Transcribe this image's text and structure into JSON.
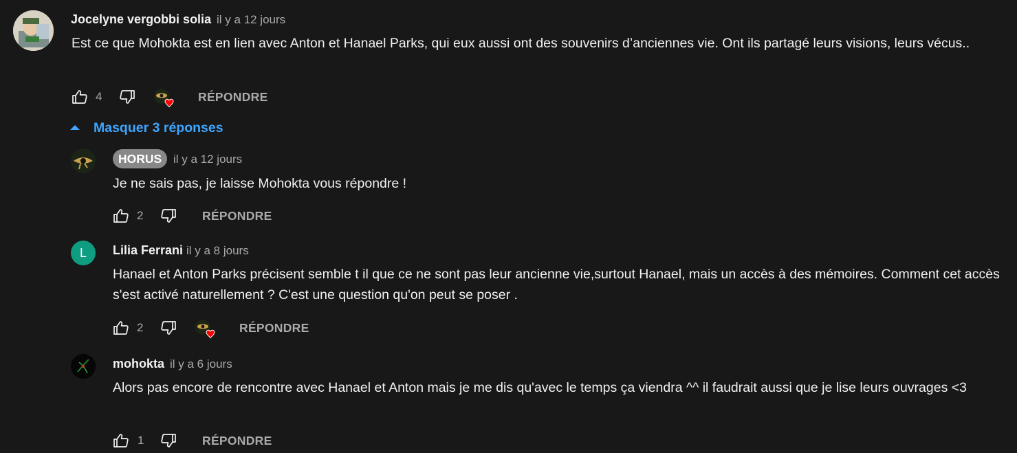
{
  "comments": [
    {
      "author": "Jocelyne vergobbi solia",
      "time": "il y a 12 jours",
      "text": "Est ce que Mohokta est en lien avec Anton et Hanael Parks, qui eux aussi ont des souvenirs d’anciennes vie. Ont ils partagé leurs visions, leurs vécus..",
      "likes": "4",
      "reply_label": "RÉPONDRE"
    }
  ],
  "toggle_replies": {
    "label": "Masquer 3 réponses",
    "color": "#3ea6ff"
  },
  "replies": [
    {
      "author": "HORUS",
      "time": "il y a 12 jours",
      "text": "Je ne sais pas, je laisse Mohokta vous répondre !",
      "likes": "2",
      "reply_label": "RÉPONDRE"
    },
    {
      "author": "Lilia Ferrani",
      "avatar_letter": "L",
      "avatar_color": "#0f9d82",
      "time": "il y a 8 jours",
      "text": "Hanael et Anton Parks précisent semble t il que ce ne sont pas leur ancienne vie,surtout Hanael, mais un accès à des mémoires. Comment cet accès s'est activé  naturellement ? C'est une question qu'on peut se poser .",
      "likes": "2",
      "reply_label": "RÉPONDRE"
    },
    {
      "author": "mohokta",
      "time": "il y a 6 jours",
      "text": "Alors pas encore de rencontre avec Hanael et Anton mais je me dis qu'avec le temps ça viendra ^^ il faudrait aussi que je lise leurs ouvrages <3",
      "likes": "1",
      "reply_label": "RÉPONDRE"
    }
  ]
}
